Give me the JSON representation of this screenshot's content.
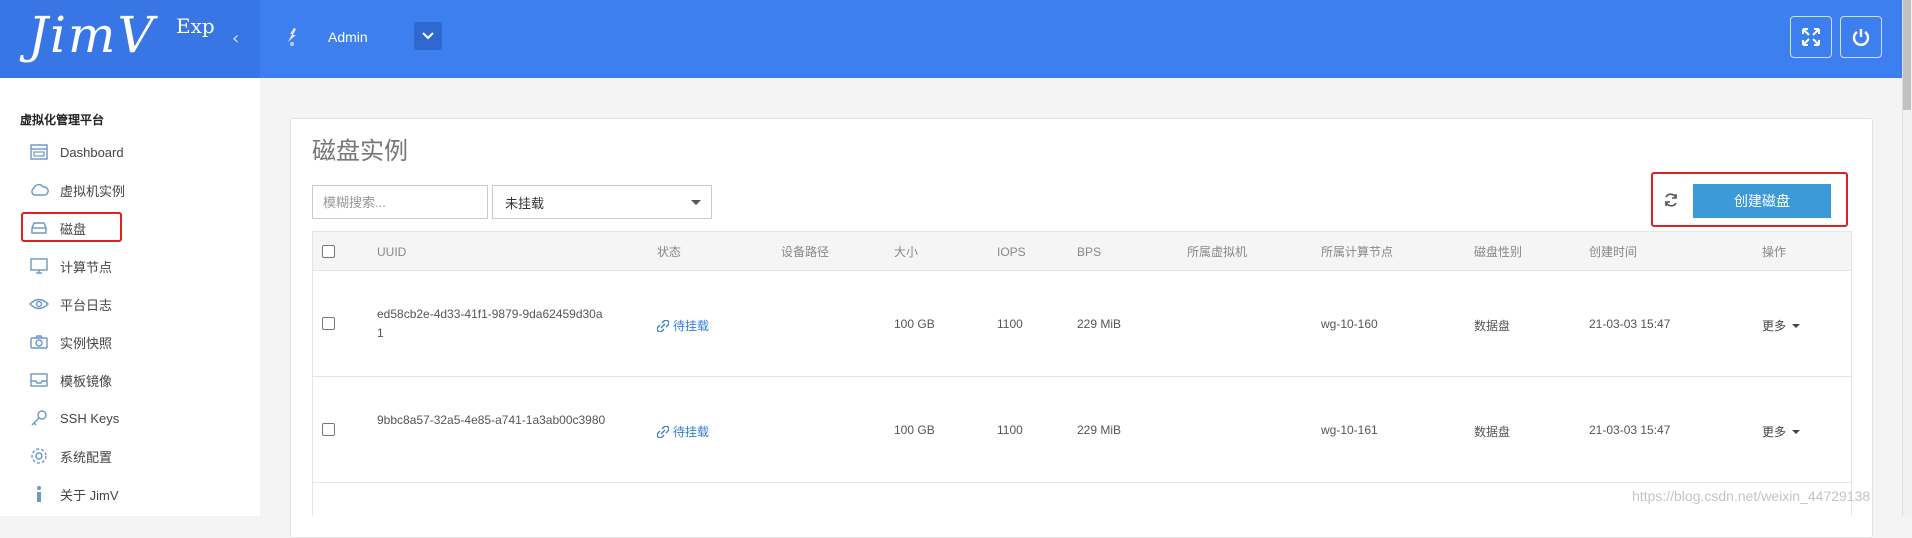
{
  "header": {
    "logo": "JimV",
    "logo_sup": "Exp",
    "collapse_icon": "‹",
    "user": "Admin"
  },
  "sidebar": {
    "title": "虚拟化管理平台",
    "items": [
      {
        "label": "Dashboard",
        "icon": "dashboard-icon"
      },
      {
        "label": "虚拟机实例",
        "icon": "cloud-icon"
      },
      {
        "label": "磁盘",
        "icon": "disk-icon"
      },
      {
        "label": "计算节点",
        "icon": "monitor-icon"
      },
      {
        "label": "平台日志",
        "icon": "eye-icon"
      },
      {
        "label": "实例快照",
        "icon": "camera-icon"
      },
      {
        "label": "模板镜像",
        "icon": "inbox-icon"
      },
      {
        "label": "SSH Keys",
        "icon": "key-icon"
      },
      {
        "label": "系统配置",
        "icon": "gear-icon"
      },
      {
        "label": "关于 JimV",
        "icon": "info-icon"
      }
    ],
    "active_index": 2
  },
  "main": {
    "title": "磁盘实例",
    "search_placeholder": "模糊搜索...",
    "filter_value": "未挂载",
    "create_label": "创建磁盘",
    "columns": [
      "UUID",
      "状态",
      "设备路径",
      "大小",
      "IOPS",
      "BPS",
      "所属虚拟机",
      "所属计算节点",
      "磁盘性别",
      "创建时间",
      "操作"
    ],
    "rows": [
      {
        "uuid_line1": "ed58cb2e-4d33-41f1-9879-9da62459d30a",
        "uuid_line2": "1",
        "status": "待挂载",
        "device_path": "",
        "size": "100 GB",
        "iops": "1100",
        "bps": "229 MiB",
        "vm": "",
        "node": "wg-10-160",
        "disk_type": "数据盘",
        "created": "21-03-03 15:47",
        "action": "更多"
      },
      {
        "uuid_line1": "9bbc8a57-32a5-4e85-a741-1a3ab00c3980",
        "uuid_line2": "",
        "status": "待挂载",
        "device_path": "",
        "size": "100 GB",
        "iops": "1100",
        "bps": "229 MiB",
        "vm": "",
        "node": "wg-10-161",
        "disk_type": "数据盘",
        "created": "21-03-03 15:47",
        "action": "更多"
      }
    ]
  },
  "watermark": "https://blog.csdn.net/weixin_44729138",
  "colors": {
    "topbar": "#3e7ff0",
    "accent": "#3c9ad8",
    "highlight": "#e02020"
  }
}
